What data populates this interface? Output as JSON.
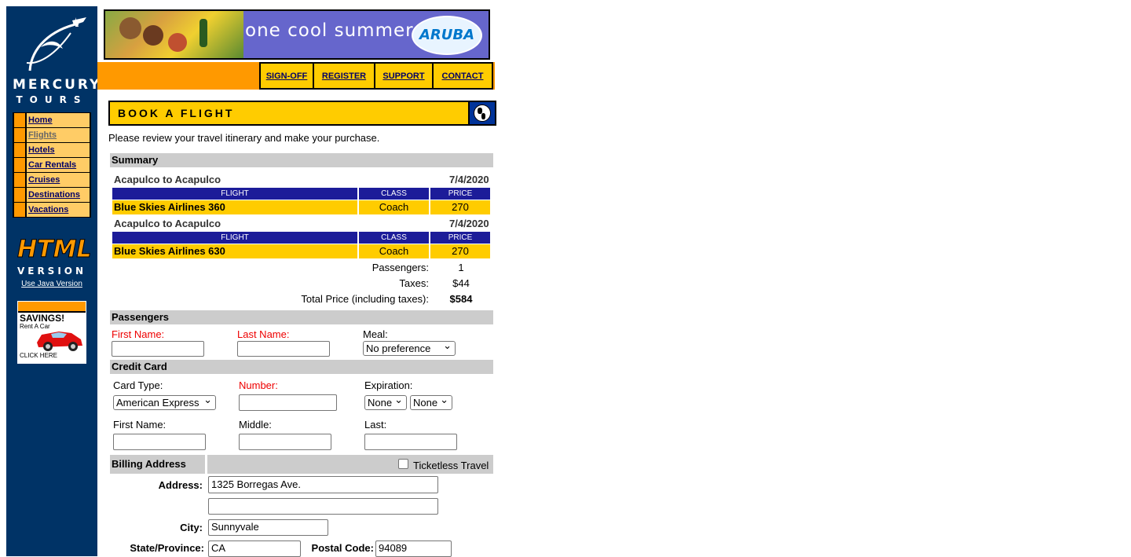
{
  "brand": {
    "name_line1": "MERCURY",
    "name_line2": "TOURS"
  },
  "banner": {
    "slogan": "one cool summer",
    "brand": "ARUBA"
  },
  "top_links": [
    "SIGN-OFF",
    "REGISTER",
    "SUPPORT",
    "CONTACT"
  ],
  "sidebar": {
    "items": [
      {
        "label": "Home"
      },
      {
        "label": "Flights"
      },
      {
        "label": "Hotels"
      },
      {
        "label": "Car Rentals"
      },
      {
        "label": "Cruises"
      },
      {
        "label": "Destinations"
      },
      {
        "label": "Vacations"
      }
    ],
    "html_version": "HTML",
    "version_word": "VERSION",
    "java_link": "Use Java Version",
    "ad": {
      "headline": "SAVINGS!",
      "sub": "Rent A Car",
      "cta": "CLICK HERE"
    }
  },
  "title": "BOOK A FLIGHT",
  "intro": "Please review your travel itinerary and make your purchase.",
  "summary": {
    "heading": "Summary",
    "headers": {
      "flight": "FLIGHT",
      "class": "CLASS",
      "price": "PRICE"
    },
    "legs": [
      {
        "route": "Acapulco to Acapulco",
        "date": "7/4/2020",
        "flight": "Blue Skies Airlines 360",
        "class": "Coach",
        "price": "270"
      },
      {
        "route": "Acapulco to Acapulco",
        "date": "7/4/2020",
        "flight": "Blue Skies Airlines 630",
        "class": "Coach",
        "price": "270"
      }
    ],
    "passengers_label": "Passengers:",
    "passengers": "1",
    "taxes_label": "Taxes:",
    "taxes": "$44",
    "total_label": "Total Price (including taxes):",
    "total": "$584"
  },
  "passengers": {
    "heading": "Passengers",
    "first_label": "First Name:",
    "last_label": "Last Name:",
    "meal_label": "Meal:",
    "meal_value": "No preference"
  },
  "credit": {
    "heading": "Credit Card",
    "type_label": "Card Type:",
    "type_value": "American Express",
    "number_label": "Number:",
    "exp_label": "Expiration:",
    "exp_month": "None",
    "exp_year": "None",
    "first_label": "First Name:",
    "middle_label": "Middle:",
    "last_label": "Last:"
  },
  "billing": {
    "heading": "Billing Address",
    "ticketless": "Ticketless Travel",
    "address_label": "Address:",
    "address1": "1325 Borregas Ave.",
    "address2": "",
    "city_label": "City:",
    "city": "Sunnyvale",
    "state_label": "State/Province:",
    "state": "CA",
    "postal_label": "Postal Code:",
    "postal": "94089"
  }
}
